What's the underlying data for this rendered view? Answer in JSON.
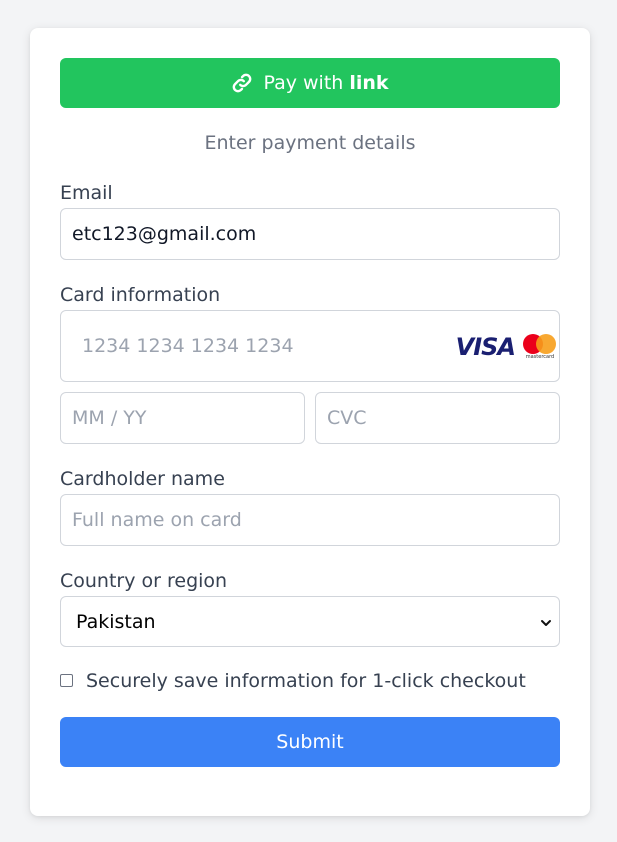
{
  "link_button": {
    "prefix": "Pay with",
    "brand": "link",
    "icon": "link-icon",
    "color": "#22c55e"
  },
  "subtitle": "Enter payment details",
  "email": {
    "label": "Email",
    "value": "etc123@gmail.com"
  },
  "card": {
    "label": "Card information",
    "number_placeholder": "1234 1234 1234 1234",
    "expiry_placeholder": "MM / YY",
    "cvc_placeholder": "CVC",
    "brands": [
      "VISA",
      "mastercard"
    ]
  },
  "cardholder": {
    "label": "Cardholder name",
    "placeholder": "Full name on card"
  },
  "country": {
    "label": "Country or region",
    "selected": "Pakistan"
  },
  "save_info": {
    "label": "Securely save information for 1-click checkout",
    "checked": false
  },
  "submit": {
    "label": "Submit",
    "color": "#3b82f6"
  }
}
